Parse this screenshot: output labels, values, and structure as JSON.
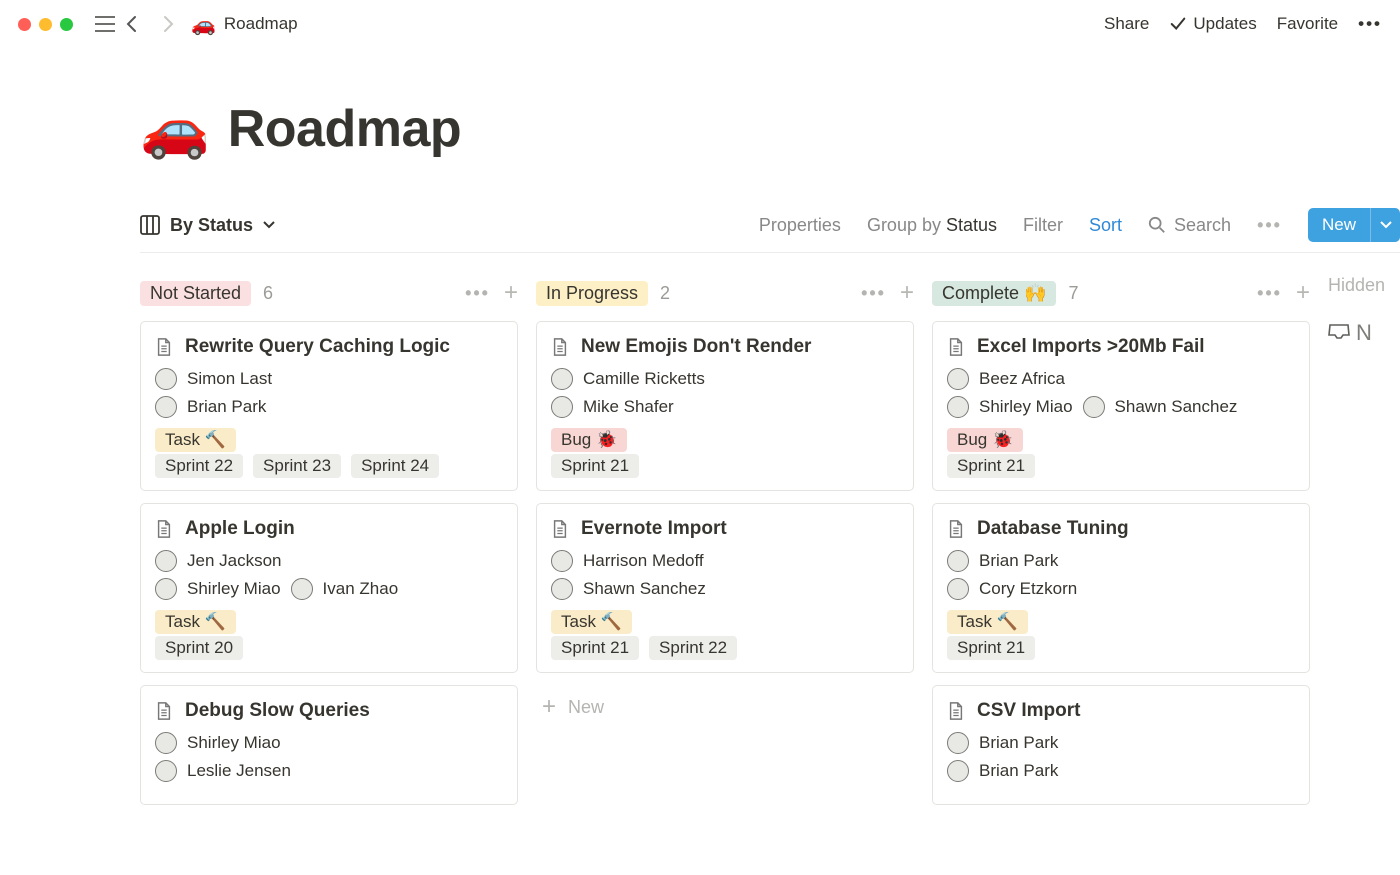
{
  "topbar": {
    "breadcrumb_icon": "🚗",
    "breadcrumb_label": "Roadmap",
    "share": "Share",
    "updates": "Updates",
    "favorite": "Favorite"
  },
  "page": {
    "icon": "🚗",
    "title": "Roadmap"
  },
  "controls": {
    "view_label": "By Status",
    "properties": "Properties",
    "group_by_prefix": "Group by ",
    "group_by_value": "Status",
    "filter": "Filter",
    "sort": "Sort",
    "search": "Search",
    "new": "New"
  },
  "hidden_label": "Hidden",
  "inbox_label": "N",
  "columns": [
    {
      "status_label": "Not Started",
      "status_color": "pink",
      "count": "6",
      "cards": [
        {
          "title": "Rewrite Query Caching Logic",
          "assignees": [
            [
              "Simon Last"
            ],
            [
              "Brian Park"
            ]
          ],
          "type_tag": "Task 🔨",
          "type_class": "task",
          "sprints": [
            "Sprint 22",
            "Sprint 23",
            "Sprint 24"
          ]
        },
        {
          "title": "Apple Login",
          "assignees": [
            [
              "Jen Jackson"
            ],
            [
              "Shirley Miao",
              "Ivan Zhao"
            ]
          ],
          "type_tag": "Task 🔨",
          "type_class": "task",
          "sprints": [
            "Sprint 20"
          ]
        },
        {
          "title": "Debug Slow Queries",
          "assignees": [
            [
              "Shirley Miao"
            ],
            [
              "Leslie Jensen"
            ]
          ]
        }
      ],
      "show_add_new": false
    },
    {
      "status_label": "In Progress",
      "status_color": "yellow",
      "count": "2",
      "cards": [
        {
          "title": "New Emojis Don't Render",
          "assignees": [
            [
              "Camille Ricketts"
            ],
            [
              "Mike Shafer"
            ]
          ],
          "type_tag": "Bug 🐞",
          "type_class": "bug",
          "sprints": [
            "Sprint 21"
          ]
        },
        {
          "title": "Evernote Import",
          "assignees": [
            [
              "Harrison Medoff"
            ],
            [
              "Shawn Sanchez"
            ]
          ],
          "type_tag": "Task 🔨",
          "type_class": "task",
          "sprints": [
            "Sprint 21",
            "Sprint 22"
          ]
        }
      ],
      "show_add_new": true,
      "add_new_label": "New"
    },
    {
      "status_label": "Complete 🙌",
      "status_color": "green",
      "count": "7",
      "cards": [
        {
          "title": "Excel Imports >20Mb Fail",
          "assignees": [
            [
              "Beez Africa"
            ],
            [
              "Shirley Miao",
              "Shawn Sanchez"
            ]
          ],
          "type_tag": "Bug 🐞",
          "type_class": "bug",
          "sprints": [
            "Sprint 21"
          ]
        },
        {
          "title": "Database Tuning",
          "assignees": [
            [
              "Brian Park"
            ],
            [
              "Cory Etzkorn"
            ]
          ],
          "type_tag": "Task 🔨",
          "type_class": "task",
          "sprints": [
            "Sprint 21"
          ]
        },
        {
          "title": "CSV Import",
          "assignees": [
            [
              "Brian Park"
            ],
            [
              "Brian Park"
            ]
          ]
        }
      ],
      "show_add_new": false
    }
  ]
}
